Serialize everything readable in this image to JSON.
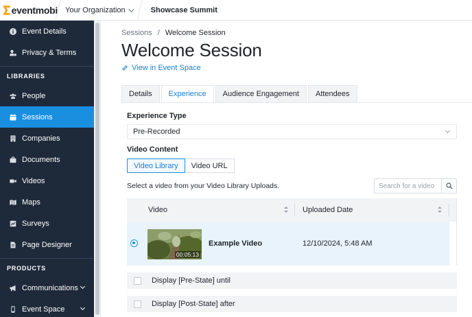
{
  "header": {
    "logo_text": "eventmobi",
    "org_name": "Your Organization",
    "event_name": "Showcase Summit"
  },
  "sidebar": {
    "items_top": [
      {
        "label": "Event Details",
        "icon": "info-icon"
      },
      {
        "label": "Privacy & Terms",
        "icon": "user-lock-icon"
      }
    ],
    "libraries_heading": "LIBRARIES",
    "libraries": [
      {
        "label": "People",
        "icon": "people-icon"
      },
      {
        "label": "Sessions",
        "icon": "calendar-icon",
        "active": true
      },
      {
        "label": "Companies",
        "icon": "building-icon"
      },
      {
        "label": "Documents",
        "icon": "briefcase-icon"
      },
      {
        "label": "Videos",
        "icon": "video-icon"
      },
      {
        "label": "Maps",
        "icon": "map-icon"
      },
      {
        "label": "Surveys",
        "icon": "survey-icon"
      },
      {
        "label": "Page Designer",
        "icon": "page-icon"
      }
    ],
    "products_heading": "PRODUCTS",
    "products": [
      {
        "label": "Communications",
        "icon": "megaphone-icon"
      },
      {
        "label": "Event Space",
        "icon": "mobile-icon"
      }
    ]
  },
  "breadcrumb": {
    "parent": "Sessions",
    "sep": "/",
    "current": "Welcome Session"
  },
  "page_title": "Welcome Session",
  "view_link": "View in Event Space",
  "tabs": [
    {
      "label": "Details"
    },
    {
      "label": "Experience",
      "active": true
    },
    {
      "label": "Audience Engagement"
    },
    {
      "label": "Attendees"
    }
  ],
  "experience": {
    "type_label": "Experience Type",
    "type_value": "Pre-Recorded",
    "content_label": "Video Content",
    "source_options": [
      "Video Library",
      "Video URL"
    ],
    "source_selected": "Video Library",
    "hint": "Select a video from your Video Library Uploads.",
    "search_placeholder": "Search for a video"
  },
  "table": {
    "col_video": "Video",
    "col_date": "Uploaded Date",
    "rows": [
      {
        "name": "Example Video",
        "date": "12/10/2024, 5:48 AM",
        "duration": "00:05:13",
        "selected": true
      }
    ]
  },
  "options": {
    "pre_state": "Display [Pre-State] until",
    "post_state": "Display [Post-State] after"
  },
  "colors": {
    "accent": "#1a8fe0",
    "sidebar_bg": "#1e2a3a",
    "logo_orange": "#f5a623"
  }
}
